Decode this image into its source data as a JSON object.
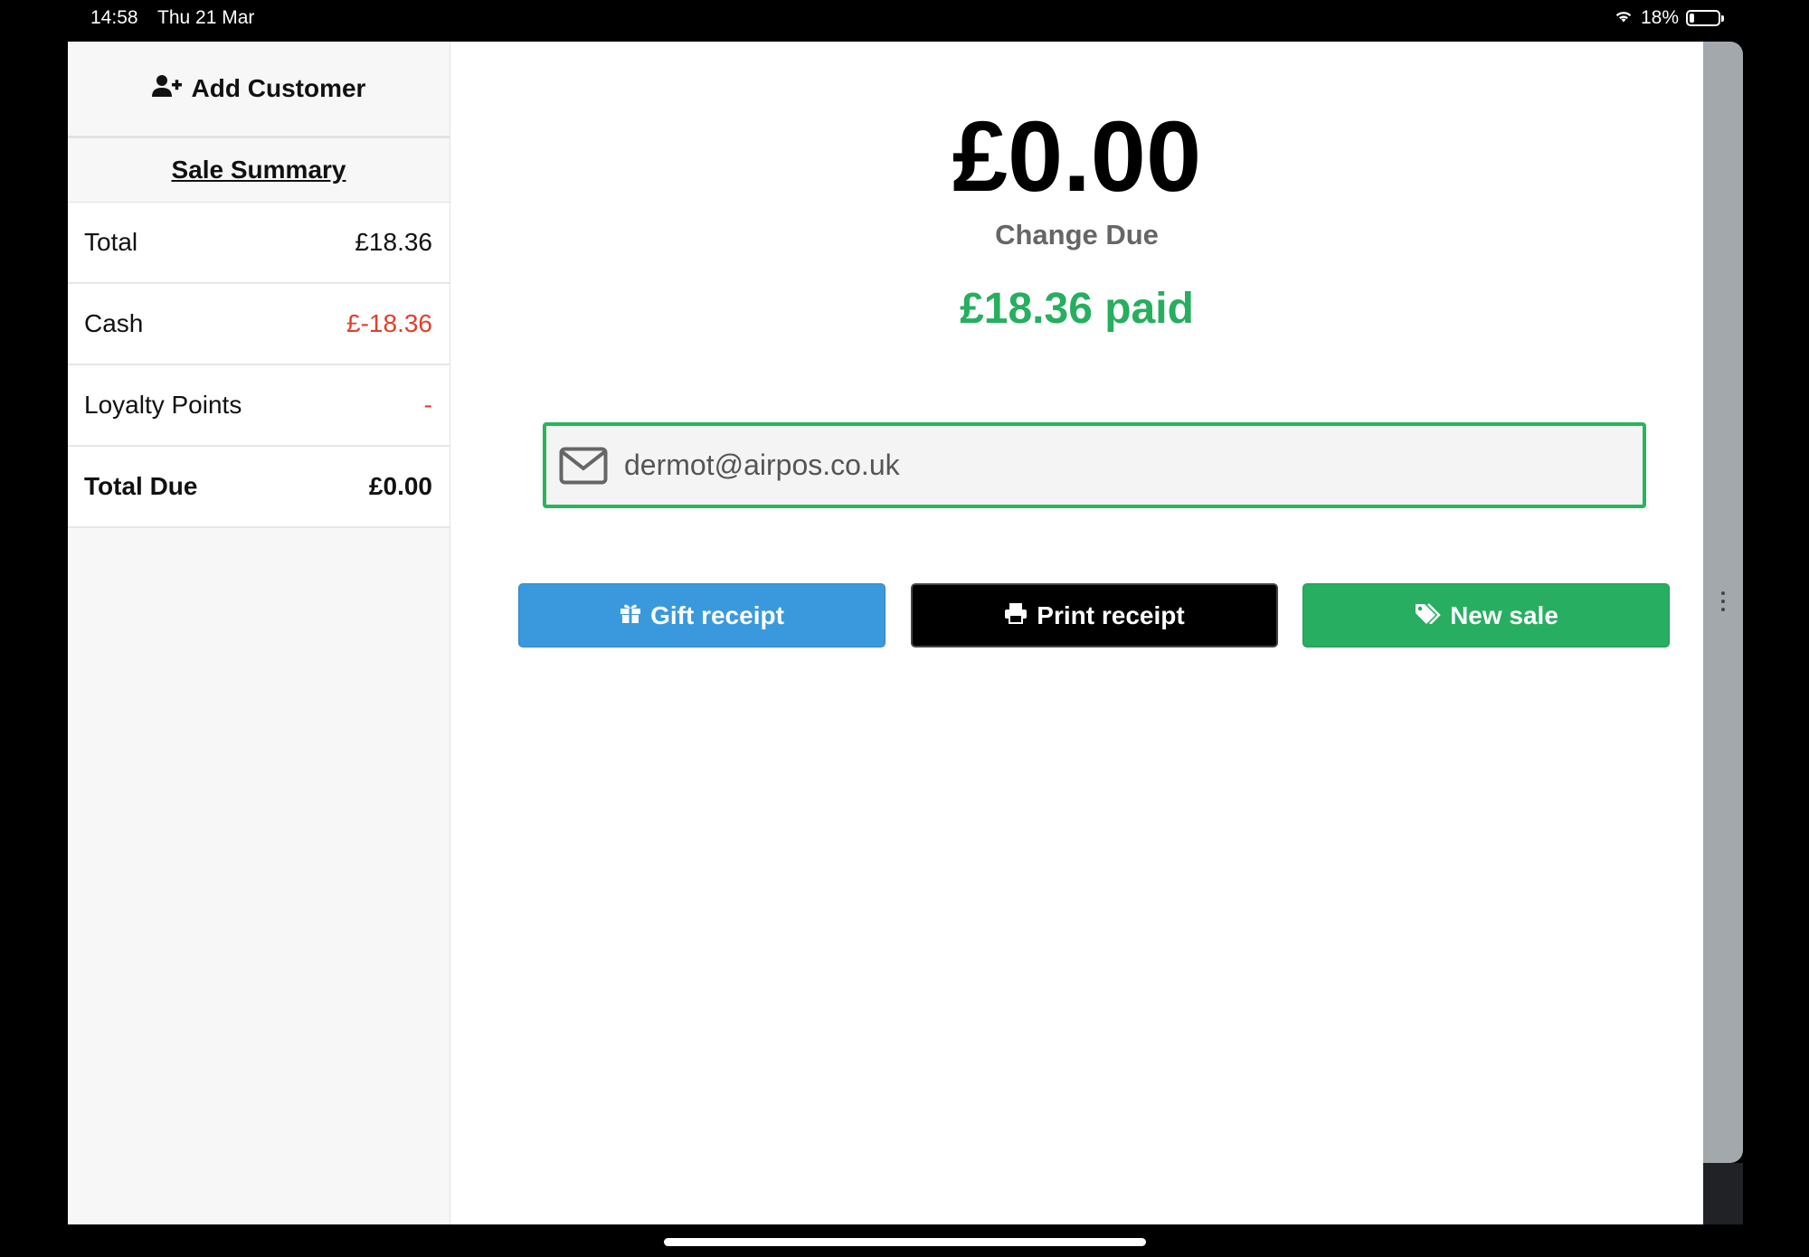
{
  "status_bar": {
    "time": "14:58",
    "date": "Thu 21 Mar",
    "battery_percent": "18%",
    "battery_level": 0.18
  },
  "sidebar": {
    "add_customer_label": "Add Customer",
    "summary_title": "Sale Summary",
    "rows": [
      {
        "label": "Total",
        "value": "£18.36"
      },
      {
        "label": "Cash",
        "value": "£-18.36"
      },
      {
        "label": "Loyalty Points",
        "value": "-"
      },
      {
        "label": "Total Due",
        "value": "£0.00"
      }
    ]
  },
  "main": {
    "change_amount": "£0.00",
    "change_label": "Change Due",
    "paid_text": "£18.36 paid",
    "email_value": "dermot@airpos.co.uk"
  },
  "buttons": {
    "gift_receipt": "Gift receipt",
    "print_receipt": "Print receipt",
    "new_sale": "New sale"
  },
  "icons": {
    "add_customer": "user-plus-icon",
    "email": "envelope-icon",
    "gift": "gift-icon",
    "print": "printer-icon",
    "new_sale": "tags-icon",
    "wifi": "wifi-icon",
    "battery": "battery-icon"
  },
  "colors": {
    "paid_green": "#27ae60",
    "gift_blue": "#3a99dc",
    "negative_red": "#e0402a",
    "email_border": "#2ab45a"
  }
}
